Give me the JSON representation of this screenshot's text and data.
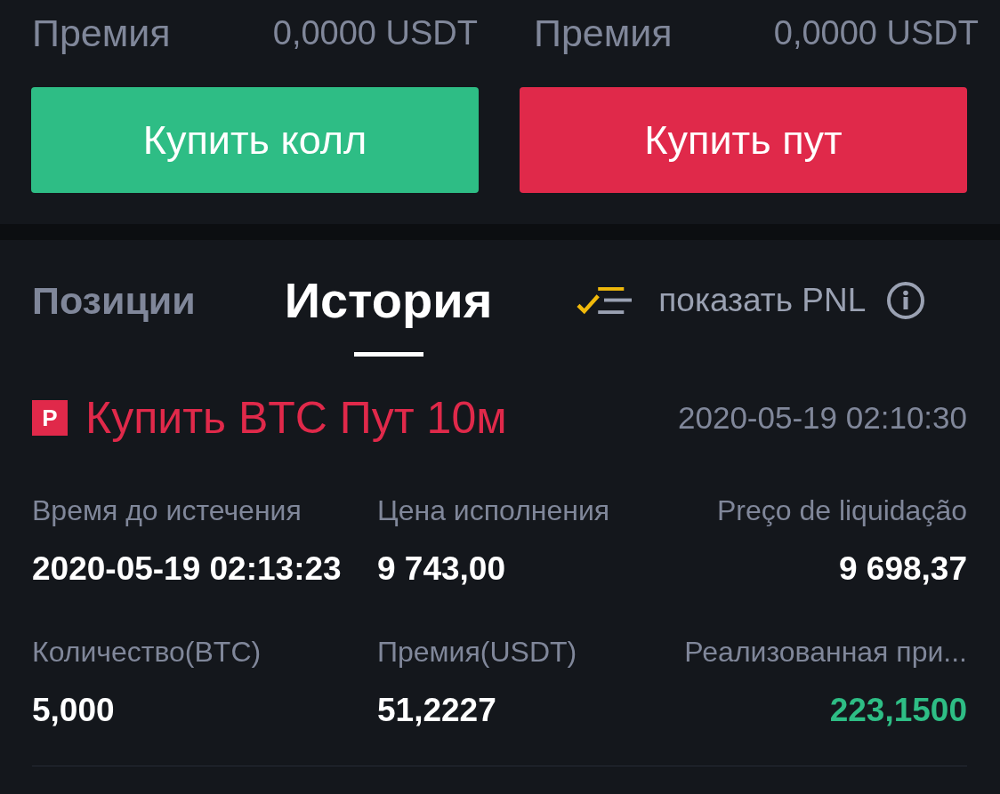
{
  "premiums": [
    {
      "label": "Премия",
      "value": "0,0000 USDT"
    },
    {
      "label": "Премия",
      "value": "0,0000 USDT"
    }
  ],
  "buttons": [
    {
      "label": "Купить колл",
      "kind": "call"
    },
    {
      "label": "Купить пут",
      "kind": "put"
    }
  ],
  "tabs": [
    {
      "label": "Позиции",
      "selected": false
    },
    {
      "label": "История",
      "selected": true
    }
  ],
  "pnl_toggle": {
    "label": "показать PNL"
  },
  "order": {
    "badge": "P",
    "title": "Купить BTC Пут 10м",
    "kind": "put",
    "time": "2020-05-19 02:10:30",
    "fields": [
      {
        "label": "Время до истечения",
        "value": "2020-05-19 02:13:23",
        "kind": "plain"
      },
      {
        "label": "Цена исполнения",
        "value": "9 743,00",
        "kind": "plain"
      },
      {
        "label": "Preço de liquidação",
        "value": "9 698,37",
        "kind": "plain"
      },
      {
        "label": "Количество(BTC)",
        "value": "5,000",
        "kind": "plain"
      },
      {
        "label": "Премия(USDT)",
        "value": "51,2227",
        "kind": "plain"
      },
      {
        "label": "Реализованная при...",
        "value": "223,1500",
        "kind": "profit"
      }
    ]
  }
}
